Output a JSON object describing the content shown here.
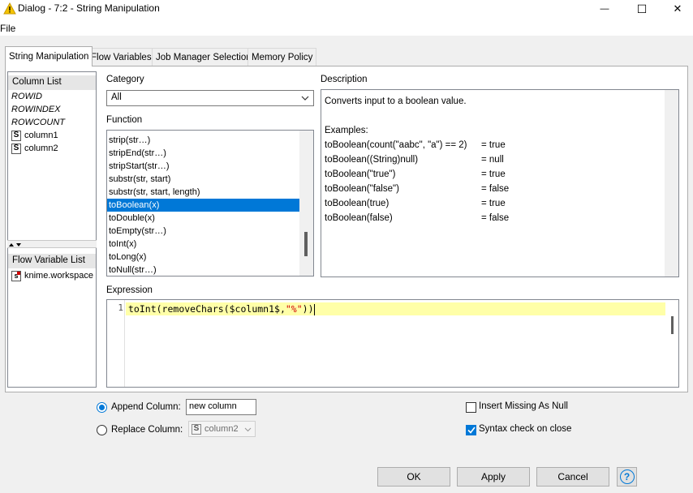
{
  "window": {
    "title": "Dialog - 7:2 - String Manipulation",
    "minimize_glyph": "—",
    "maximize_glyph": "☐",
    "close_glyph": "✕"
  },
  "menu": {
    "file": "File"
  },
  "tabs": [
    {
      "label": "String Manipulation",
      "active": true
    },
    {
      "label": "Flow Variables"
    },
    {
      "label": "Job Manager Selection"
    },
    {
      "label": "Memory Policy"
    }
  ],
  "column_list": {
    "header": "Column List",
    "items": [
      {
        "label": "ROWID",
        "type": "special"
      },
      {
        "label": "ROWINDEX",
        "type": "special"
      },
      {
        "label": "ROWCOUNT",
        "type": "special"
      },
      {
        "label": "column1",
        "type": "string",
        "badge": "S"
      },
      {
        "label": "column2",
        "type": "string",
        "badge": "S"
      }
    ]
  },
  "flow_variable_list": {
    "header": "Flow Variable List",
    "items": [
      {
        "label": "knime.workspace",
        "badge": "s"
      }
    ]
  },
  "category": {
    "label": "Category",
    "value": "All"
  },
  "function": {
    "label": "Function",
    "items": [
      "strip(str…)",
      "stripEnd(str…)",
      "stripStart(str…)",
      "substr(str, start)",
      "substr(str, start, length)",
      "toBoolean(x)",
      "toDouble(x)",
      "toEmpty(str…)",
      "toInt(x)",
      "toLong(x)",
      "toNull(str…)"
    ],
    "selected_index": 5
  },
  "description": {
    "label": "Description",
    "summary": "Converts input to a boolean value.",
    "examples_label": "Examples:",
    "examples": [
      {
        "expr": "toBoolean(count(\"aabc\", \"a\") == 2)",
        "result": "= true"
      },
      {
        "expr": "toBoolean((String)null)",
        "result": "= null"
      },
      {
        "expr": "toBoolean(\"true\")",
        "result": "= true"
      },
      {
        "expr": "toBoolean(\"false\")",
        "result": "= false"
      },
      {
        "expr": "toBoolean(true)",
        "result": "= true"
      },
      {
        "expr": "toBoolean(false)",
        "result": "= false"
      }
    ]
  },
  "expression": {
    "label": "Expression",
    "line_number": "1",
    "code_parts": [
      "toInt(",
      "removeChars($column1$,",
      "\"%\"",
      "))"
    ]
  },
  "options": {
    "append_label": "Append Column:",
    "append_value": "new column",
    "append_selected": true,
    "replace_label": "Replace Column:",
    "replace_badge": "S",
    "replace_value": "column2",
    "insert_missing_label": "Insert Missing As Null",
    "insert_missing_checked": false,
    "syntax_check_label": "Syntax check on close",
    "syntax_check_checked": true
  },
  "buttons": {
    "ok": "OK",
    "apply": "Apply",
    "cancel": "Cancel",
    "help": "?"
  },
  "colors": {
    "selection": "#0078d7",
    "warning": "#f5c400",
    "expr_highlight": "#ffffa8",
    "string_literal": "#d00000"
  }
}
